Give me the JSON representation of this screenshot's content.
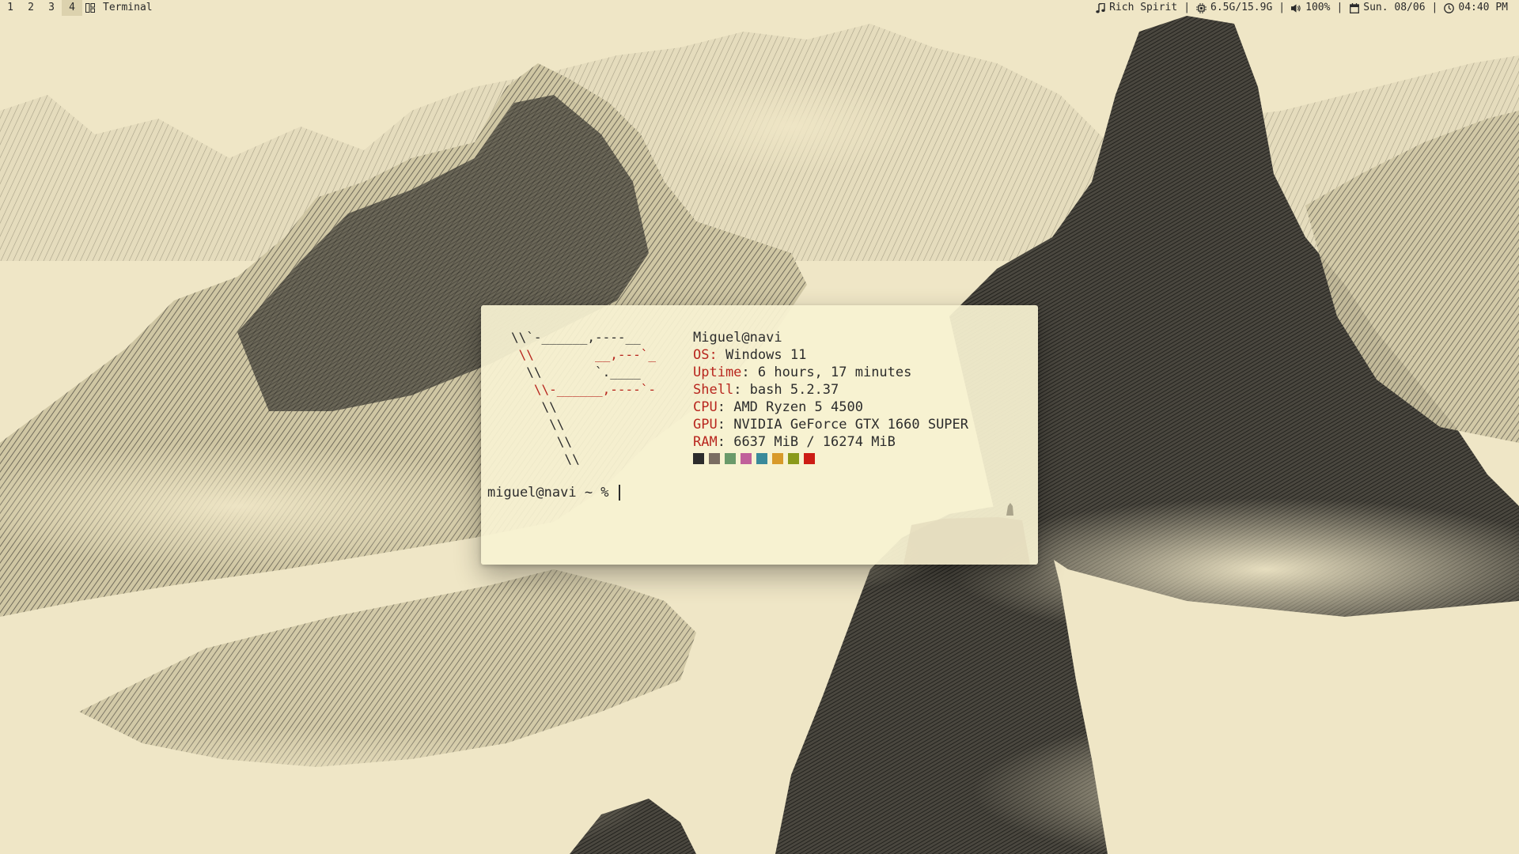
{
  "topbar": {
    "workspaces": [
      "1",
      "2",
      "3",
      "4"
    ],
    "active_workspace": "4",
    "layout_icon": "tiling-layout-icon",
    "window_title": "Terminal",
    "music": {
      "icon": "music-note-icon",
      "label": "Rich Spirit"
    },
    "memory": {
      "icon": "cpu-chip-icon",
      "label": "6.5G/15.9G"
    },
    "volume": {
      "icon": "speaker-icon",
      "label": "100%"
    },
    "date": {
      "icon": "calendar-icon",
      "label": "Sun. 08/06"
    },
    "clock": {
      "icon": "clock-icon",
      "label": "04:40 PM"
    },
    "separator": "|"
  },
  "terminal": {
    "ascii_art": [
      "\\\\`-______,----__",
      " \\\\        __,---`_",
      "  \\\\       `.____",
      "   \\\\-______,----`-",
      "    \\\\",
      "     \\\\",
      "      \\\\",
      "       \\\\"
    ],
    "user_host": "Miguel@navi",
    "info": [
      {
        "key": "OS",
        "value": "Windows 11"
      },
      {
        "key": "Uptime",
        "value": "6 hours, 17 minutes"
      },
      {
        "key": "Shell",
        "value": "bash 5.2.37"
      },
      {
        "key": "CPU",
        "value": "AMD Ryzen 5 4500"
      },
      {
        "key": "GPU",
        "value": "NVIDIA GeForce GTX 1660 SUPER"
      },
      {
        "key": "RAM",
        "value": "6637 MiB / 16274 MiB"
      }
    ],
    "palette": [
      "#2c2c2c",
      "#7a6d62",
      "#6a9a6a",
      "#c0609a",
      "#3a8a9a",
      "#d89a2a",
      "#8a9a1a",
      "#cc1c14"
    ],
    "prompt": "miguel@navi ~ % "
  },
  "colors": {
    "background": "#efe6c6",
    "ink": "#2c2c2c",
    "accent_red": "#b8261e"
  }
}
